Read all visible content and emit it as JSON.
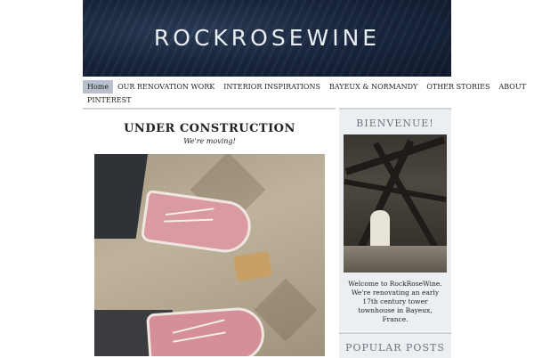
{
  "site": {
    "title": "ROCKROSEWINE"
  },
  "nav": {
    "items": [
      {
        "label": "Home",
        "active": true
      },
      {
        "label": "OUR RENOVATION WORK"
      },
      {
        "label": "INTERIOR INSPIRATIONS"
      },
      {
        "label": "BAYEUX & NORMANDY"
      },
      {
        "label": "OTHER STORIES"
      },
      {
        "label": "ABOUT"
      },
      {
        "label": "PINTEREST"
      }
    ]
  },
  "post": {
    "title": "UNDER CONSTRUCTION",
    "subtitle": "We're moving!"
  },
  "sidebar": {
    "welcome": {
      "title": "BIENVENUE!",
      "text": "Welcome to RockRoseWine. We're renovating an early 17th century tower townhouse in Bayeux, France."
    },
    "popular": {
      "title": "POPULAR POSTS"
    }
  },
  "colors": {
    "banner": "#1a2740",
    "nav_active": "#b7c0cc",
    "widget_bg": "#eceff2",
    "widget_title": "#6a7480"
  }
}
